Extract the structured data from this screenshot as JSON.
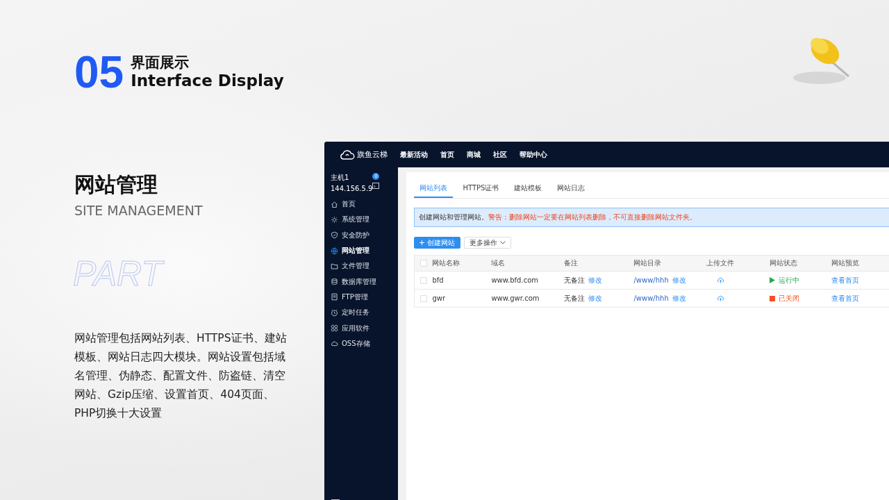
{
  "slide": {
    "number": "05",
    "title": "界面展示",
    "title_en": "Interface Display",
    "watermark": "PART",
    "section_title": "网站管理",
    "section_subtitle": "SITE MANAGEMENT",
    "description": "网站管理包括网站列表、HTTPS证书、建站模板、网站日志四大模块。网站设置包括域名管理、伪静态、配置文件、防盗链、清空网站、Gzip压缩、设置首页、404页面、PHP切换十大设置"
  },
  "app": {
    "brand": "旗鱼云梯",
    "nav": [
      "最新活动",
      "首页",
      "商城",
      "社区",
      "帮助中心"
    ],
    "host": {
      "name": "主机1",
      "ip": "144.156.5.9",
      "badge": "0"
    },
    "sidebar": [
      {
        "label": "首页",
        "selected": false
      },
      {
        "label": "系统管理",
        "selected": false
      },
      {
        "label": "安全防护",
        "selected": false
      },
      {
        "label": "网站管理",
        "selected": true
      },
      {
        "label": "文件管理",
        "selected": false
      },
      {
        "label": "数据库管理",
        "selected": false
      },
      {
        "label": "FTP管理",
        "selected": false
      },
      {
        "label": "定时任务",
        "selected": false
      },
      {
        "label": "应用软件",
        "selected": false
      },
      {
        "label": "OSS存储",
        "selected": false
      }
    ],
    "tabs": [
      {
        "label": "网站列表",
        "selected": true
      },
      {
        "label": "HTTPS证书",
        "selected": false
      },
      {
        "label": "建站模板",
        "selected": false
      },
      {
        "label": "网站日志",
        "selected": false
      }
    ],
    "notice": {
      "text": "创建网站和管理网站。",
      "warning": "警告：删除网站一定要在网站列表删除，不可直接删除网站文件夹。"
    },
    "buttons": {
      "create": "创建网站",
      "more": "更多操作"
    },
    "table": {
      "select_all_checked": false,
      "columns": [
        "网站名称",
        "域名",
        "备注",
        "网站目录",
        "上传文件",
        "网站状态",
        "网站预览"
      ],
      "rows": [
        {
          "checked": false,
          "name": "bfd",
          "domain": "www.bfd.com",
          "note": "无备注",
          "note_action": "修改",
          "dir": "/www/hhh",
          "dir_action": "修改",
          "status": {
            "kind": "running",
            "text": "运行中"
          },
          "preview": "查看首页"
        },
        {
          "checked": false,
          "name": "gwr",
          "domain": "www.gwr.com",
          "note": "无备注",
          "note_action": "修改",
          "dir": "/www/hhh",
          "dir_action": "修改",
          "status": {
            "kind": "stopped",
            "text": "已关闭"
          },
          "preview": "查看首页"
        }
      ]
    }
  }
}
